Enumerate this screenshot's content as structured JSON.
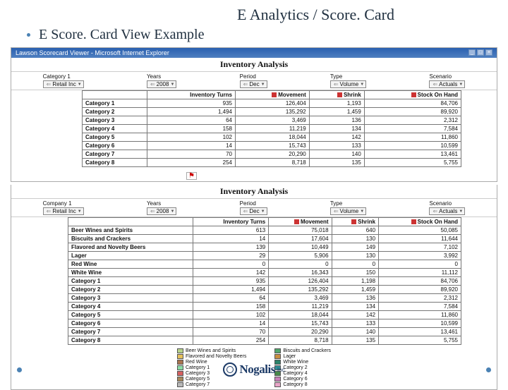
{
  "slide": {
    "title": "E Analytics / Score. Card",
    "bullet": "E Score. Card View Example"
  },
  "window": {
    "title": "Lawson Scorecard Viewer - Microsoft Internet Explorer"
  },
  "panel1": {
    "title": "Inventory Analysis",
    "filters": {
      "f1": {
        "label": "Category 1",
        "value": "Retail Inc"
      },
      "f2": {
        "label": "Years",
        "value": "2008"
      },
      "f3": {
        "label": "Period",
        "value": "Dec"
      },
      "f4": {
        "label": "Type",
        "value": "Volume"
      },
      "f5": {
        "label": "Scenario",
        "value": "Actuals"
      }
    },
    "headers": {
      "c1": "Inventory Turns",
      "c2": "Movement",
      "c3": "Shrink",
      "c4": "Stock On Hand"
    },
    "rows": [
      {
        "name": "Category 1",
        "c1": "935",
        "c2": "126,404",
        "c3": "1,193",
        "c4": "84,706"
      },
      {
        "name": "Category 2",
        "c1": "1,494",
        "c2": "135,292",
        "c3": "1,459",
        "c4": "89,920"
      },
      {
        "name": "Category 3",
        "c1": "64",
        "c2": "3,469",
        "c3": "136",
        "c4": "2,312"
      },
      {
        "name": "Category 4",
        "c1": "158",
        "c2": "11,219",
        "c3": "134",
        "c4": "7,584"
      },
      {
        "name": "Category 5",
        "c1": "102",
        "c2": "18,044",
        "c3": "142",
        "c4": "11,860"
      },
      {
        "name": "Category 6",
        "c1": "14",
        "c2": "15,743",
        "c3": "133",
        "c4": "10,599"
      },
      {
        "name": "Category 7",
        "c1": "70",
        "c2": "20,290",
        "c3": "140",
        "c4": "13,461"
      },
      {
        "name": "Category 8",
        "c1": "254",
        "c2": "8,718",
        "c3": "135",
        "c4": "5,755"
      }
    ]
  },
  "panel2": {
    "title": "Inventory Analysis",
    "filters": {
      "f1": {
        "label": "Company 1",
        "value": "Retail Inc"
      },
      "f2": {
        "label": "Years",
        "value": "2008"
      },
      "f3": {
        "label": "Period",
        "value": "Dec"
      },
      "f4": {
        "label": "Type",
        "value": "Volume"
      },
      "f5": {
        "label": "Scenario",
        "value": "Actuals"
      }
    },
    "headers": {
      "c1": "Inventory Turns",
      "c2": "Movement",
      "c3": "Shrink",
      "c4": "Stock On Hand"
    },
    "rows": [
      {
        "name": "Beer Wines and Spirits",
        "c1": "613",
        "c2": "75,018",
        "c3": "640",
        "c4": "50,085"
      },
      {
        "name": "Biscuits and Crackers",
        "c1": "14",
        "c2": "17,604",
        "c3": "130",
        "c4": "11,644"
      },
      {
        "name": "Flavored and Novelty Beers",
        "c1": "139",
        "c2": "10,449",
        "c3": "149",
        "c4": "7,102"
      },
      {
        "name": "Lager",
        "c1": "29",
        "c2": "5,906",
        "c3": "130",
        "c4": "3,992"
      },
      {
        "name": "Red Wine",
        "c1": "0",
        "c2": "0",
        "c3": "0",
        "c4": "0"
      },
      {
        "name": "White Wine",
        "c1": "142",
        "c2": "16,343",
        "c3": "150",
        "c4": "11,112"
      },
      {
        "name": "Category 1",
        "c1": "935",
        "c2": "126,404",
        "c3": "1,198",
        "c4": "84,706"
      },
      {
        "name": "Category 2",
        "c1": "1,494",
        "c2": "135,292",
        "c3": "1,459",
        "c4": "89,920"
      },
      {
        "name": "Category 3",
        "c1": "64",
        "c2": "3,469",
        "c3": "136",
        "c4": "2,312"
      },
      {
        "name": "Category 4",
        "c1": "158",
        "c2": "11,219",
        "c3": "134",
        "c4": "7,584"
      },
      {
        "name": "Category 5",
        "c1": "102",
        "c2": "18,044",
        "c3": "142",
        "c4": "11,860"
      },
      {
        "name": "Category 6",
        "c1": "14",
        "c2": "15,743",
        "c3": "133",
        "c4": "10,599"
      },
      {
        "name": "Category 7",
        "c1": "70",
        "c2": "20,290",
        "c3": "140",
        "c4": "13,461"
      },
      {
        "name": "Category 8",
        "c1": "254",
        "c2": "8,718",
        "c3": "135",
        "c4": "5,755"
      }
    ]
  },
  "chart_data": {
    "type": "table",
    "note": "two inventory analysis tables; numeric columns summarised in panel1.rows and panel2.rows"
  },
  "legend": {
    "colA": [
      {
        "label": "Beer Wines and Spirits",
        "color": "#b7d28a"
      },
      {
        "label": "Flavored and Novelty Beers",
        "color": "#e7c15a"
      },
      {
        "label": "Red Wine",
        "color": "#a9744f"
      },
      {
        "label": "Category 1",
        "color": "#8cdca5"
      },
      {
        "label": "Category 3",
        "color": "#d65f5f"
      },
      {
        "label": "Category 5",
        "color": "#a6885c"
      },
      {
        "label": "Category 7",
        "color": "#b9b9b9"
      }
    ],
    "colB": [
      {
        "label": "Biscuits and Crackers",
        "color": "#52a76c"
      },
      {
        "label": "Lager",
        "color": "#c98e3f"
      },
      {
        "label": "White Wine",
        "color": "#2c836a"
      },
      {
        "label": "Category 2",
        "color": "#2e8f96"
      },
      {
        "label": "Category 4",
        "color": "#468a49"
      },
      {
        "label": "Category 6",
        "color": "#c67fb8"
      },
      {
        "label": "Category 8",
        "color": "#e9a5c8"
      }
    ]
  },
  "logo": {
    "name": "Nogalis",
    "suffix": "Inc"
  }
}
